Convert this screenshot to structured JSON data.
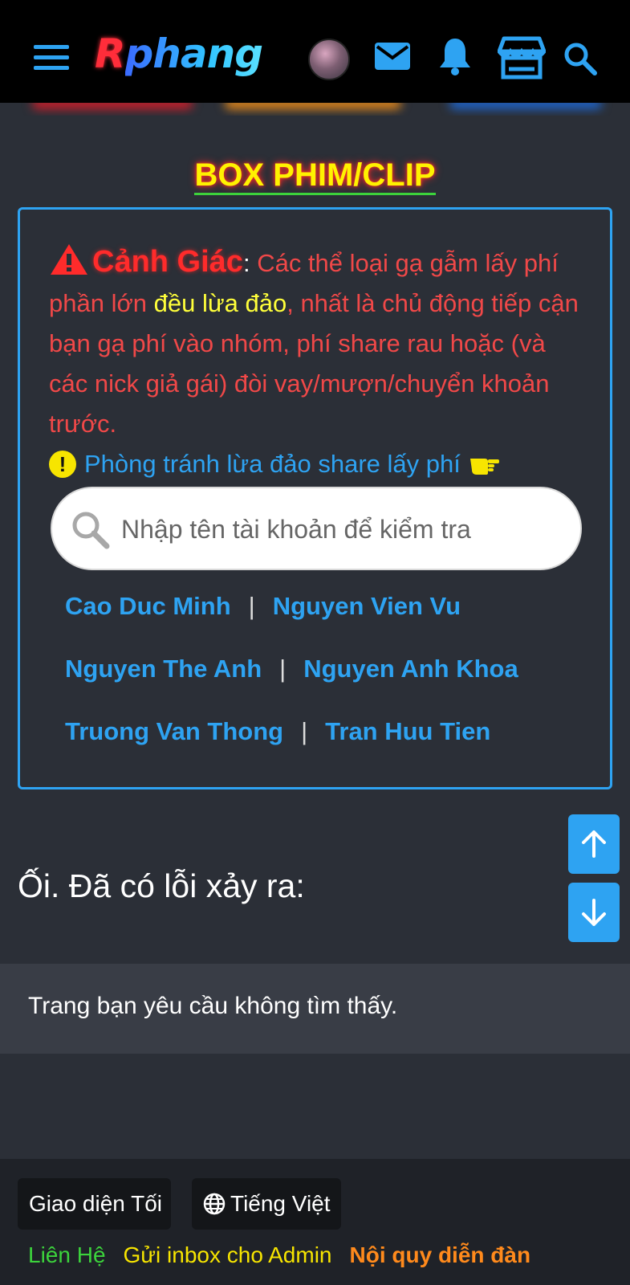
{
  "header": {
    "logo_first": "R",
    "logo_rest": "phang",
    "icons": [
      "menu-icon",
      "avatar",
      "mail-icon",
      "bell-icon",
      "store-icon",
      "search-icon"
    ]
  },
  "box_title": "BOX PHIM/CLIP",
  "warning": {
    "title": "Cảnh Giác",
    "colon": ":",
    "text_1": " Các thể loại gạ gẫm lấy phí phần lớn ",
    "highlight": "đều lừa đảo",
    "text_2": ", nhất là chủ động tiếp cận bạn gạ phí vào nhóm, phí share rau hoặc (và các nick giả gái) đòi vay/mượn/chuyển khoản trước."
  },
  "tip": {
    "icon": "!",
    "text": "Phòng tránh lừa đảo share lấy phí"
  },
  "search": {
    "placeholder": "Nhập tên tài khoản để kiểm tra"
  },
  "names": [
    {
      "left": "Cao Duc Minh",
      "sep": "|",
      "right": "Nguyen Vien Vu"
    },
    {
      "left": "Nguyen The Anh",
      "sep": "|",
      "right": "Nguyen Anh Khoa"
    },
    {
      "left": "Truong Van Thong",
      "sep": "|",
      "right": "Tran Huu Tien"
    }
  ],
  "error": {
    "title": "Ối. Đã có lỗi xảy ra:",
    "message": "Trang bạn yêu cầu không tìm thấy."
  },
  "footer": {
    "theme_button": "Giao diện Tối",
    "language_button": "Tiếng Việt",
    "links": [
      {
        "label": "Liên Hệ",
        "color": "#3cd33c"
      },
      {
        "label": "Gửi inbox cho Admin",
        "color": "#f7e500"
      },
      {
        "label": "Nội quy diễn đàn",
        "color": "#ff8a1c"
      }
    ]
  },
  "colors": {
    "accent": "#2ea3f2",
    "warning_red": "#f04848",
    "highlight_yellow": "#ffff3a"
  }
}
